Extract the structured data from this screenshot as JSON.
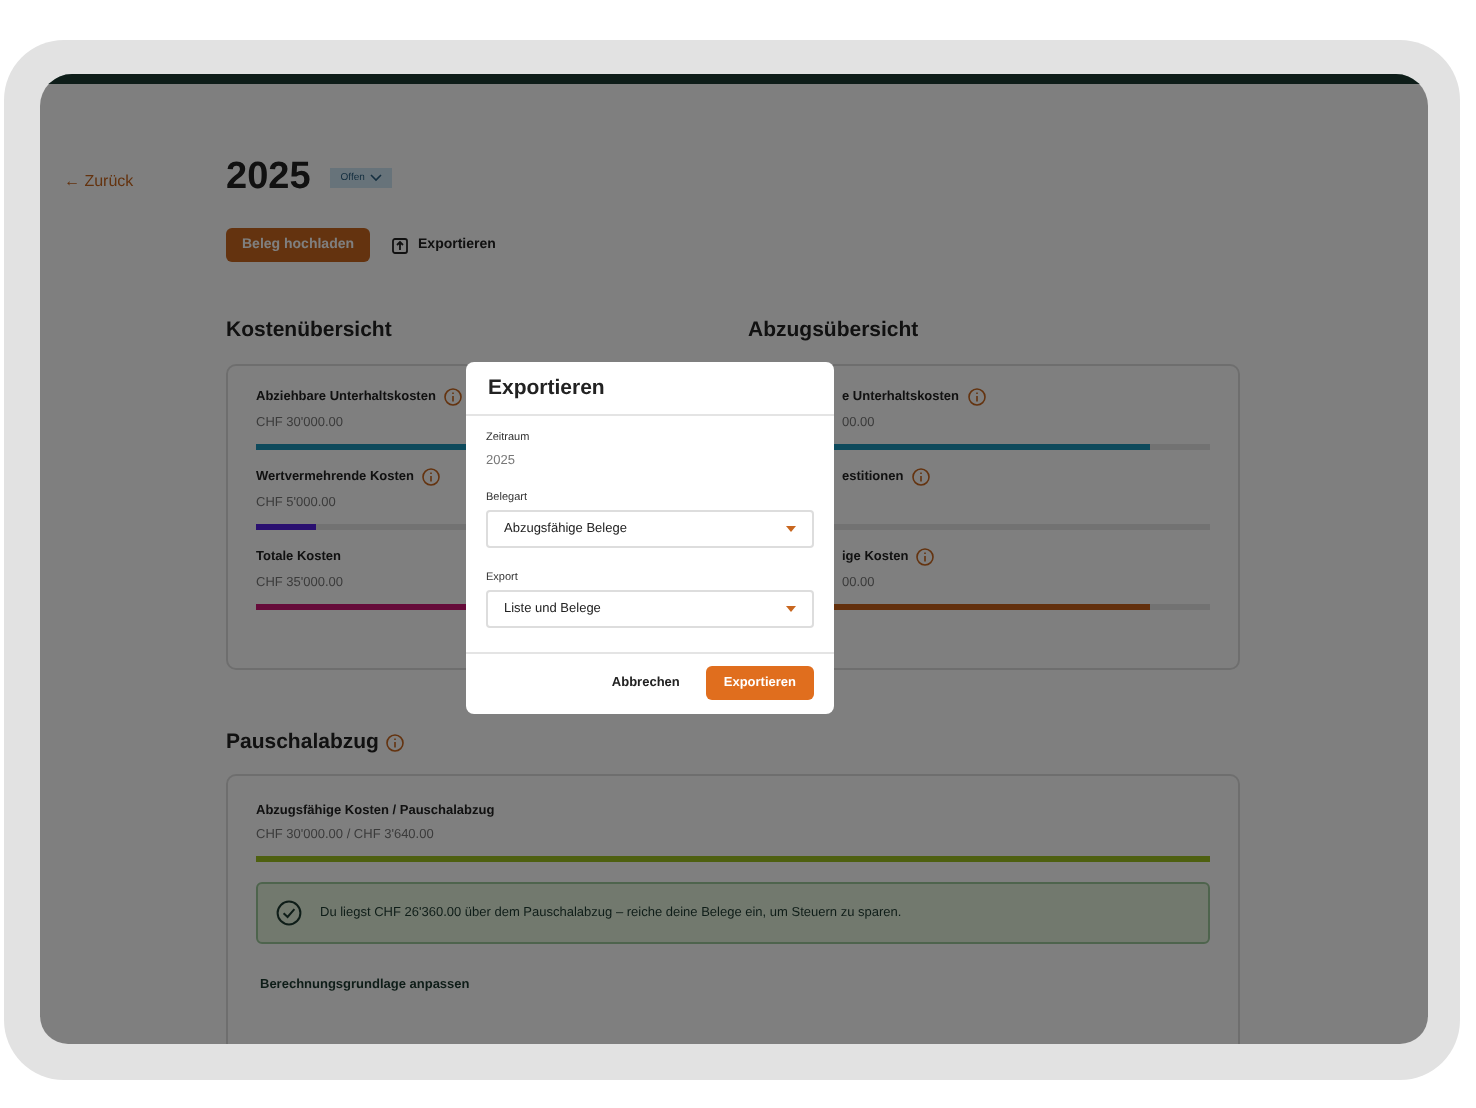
{
  "back_link": "← Zurück",
  "header": {
    "title": "2025",
    "status": "Offen",
    "upload_button": "Beleg hochladen",
    "export_link": "Exportieren"
  },
  "cost_overview": {
    "title": "Kostenübersicht",
    "items": [
      {
        "label": "Abziehbare Unterhaltskosten",
        "info": true,
        "amount": "CHF 30'000.00",
        "level": 0.86,
        "color": "#0e4a5c"
      },
      {
        "label": "Wertvermehrende Kosten",
        "info": true,
        "amount": "CHF 5'000.00",
        "level": 0.14,
        "color": "#2a1070"
      },
      {
        "label": "Totale Kosten",
        "info": false,
        "amount": "CHF 35'000.00",
        "level": 1,
        "color": "#660b3a"
      }
    ]
  },
  "deduction_overview": {
    "title": "Abzugsübersicht",
    "items": [
      {
        "label": "e Unterhaltskosten",
        "info": true,
        "amount": "00.00",
        "level": 0.86,
        "color": "#0e4a5c"
      },
      {
        "label": "estitionen",
        "info": true,
        "level": 0
      },
      {
        "label": "ige Kosten",
        "info": true,
        "amount": "00.00",
        "level": 0.86,
        "color": "#63300d"
      }
    ]
  },
  "flat_rate": {
    "title": "Pauschalabzug",
    "label": "Abzugsfähige Kosten / Pauschalabzug",
    "amount": "CHF 30'000.00 / CHF 3'640.00",
    "level": 1,
    "notice": "Du liegst CHF 26'360.00 über dem Pauschalabzug – reiche deine Belege ein, um Steuern zu sparen.",
    "adjust_link": "Berechnungsgrundlage anpassen"
  },
  "dialog": {
    "title": "Exportieren",
    "period_label": "Zeitraum",
    "period_value": "2025",
    "fields": [
      {
        "label": "Belegart",
        "value": "Abzugsfähige Belege"
      },
      {
        "label": "Export",
        "value": "Liste und Belege"
      }
    ],
    "cancel_button": "Abbrechen",
    "confirm_button": "Exportieren"
  }
}
